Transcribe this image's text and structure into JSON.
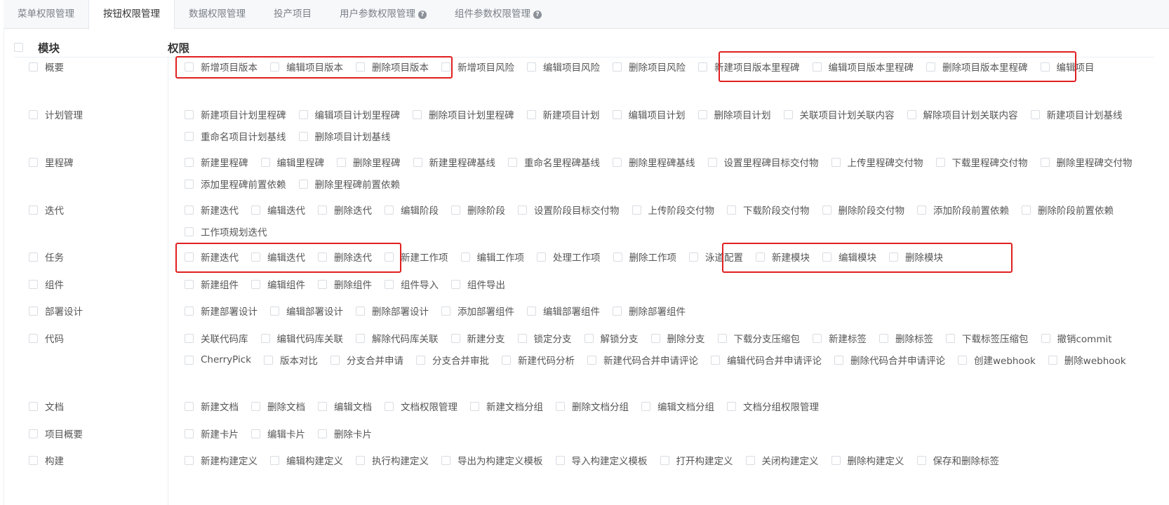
{
  "tabs": [
    {
      "label": "菜单权限管理",
      "active": false,
      "help": false
    },
    {
      "label": "按钮权限管理",
      "active": true,
      "help": false
    },
    {
      "label": "数据权限管理",
      "active": false,
      "help": false
    },
    {
      "label": "投产项目",
      "active": false,
      "help": false
    },
    {
      "label": "用户参数权限管理",
      "active": false,
      "help": true
    },
    {
      "label": "组件参数权限管理",
      "active": false,
      "help": true
    }
  ],
  "header": {
    "module": "模块",
    "permission": "权限"
  },
  "help_glyph": "?",
  "accent_color": "#e02020",
  "modules": [
    {
      "name": "概要",
      "perms": [
        "新增项目版本",
        "编辑项目版本",
        "删除项目版本",
        "新增项目风险",
        "编辑项目风险",
        "删除项目风险",
        "新建项目版本里程碑",
        "编辑项目版本里程碑",
        "删除项目版本里程碑",
        "编辑项目"
      ]
    },
    {
      "name": "计划管理",
      "perms": [
        "新建项目计划里程碑",
        "编辑项目计划里程碑",
        "删除项目计划里程碑",
        "新建项目计划",
        "编辑项目计划",
        "删除项目计划",
        "关联项目计划关联内容",
        "解除项目计划关联内容",
        "新建项目计划基线",
        "重命名项目计划基线",
        "删除项目计划基线"
      ]
    },
    {
      "name": "里程碑",
      "perms": [
        "新建里程碑",
        "编辑里程碑",
        "删除里程碑",
        "新建里程碑基线",
        "重命名里程碑基线",
        "删除里程碑基线",
        "设置里程碑目标交付物",
        "上传里程碑交付物",
        "下载里程碑交付物",
        "删除里程碑交付物",
        "添加里程碑前置依赖",
        "删除里程碑前置依赖"
      ]
    },
    {
      "name": "迭代",
      "perms": [
        "新建迭代",
        "编辑迭代",
        "删除迭代",
        "编辑阶段",
        "删除阶段",
        "设置阶段目标交付物",
        "上传阶段交付物",
        "下载阶段交付物",
        "删除阶段交付物",
        "添加阶段前置依赖",
        "删除阶段前置依赖",
        "工作项规划迭代"
      ]
    },
    {
      "name": "任务",
      "perms": [
        "新建迭代",
        "编辑迭代",
        "删除迭代",
        "新建工作项",
        "编辑工作项",
        "处理工作项",
        "删除工作项",
        "泳道配置",
        "新建模块",
        "编辑模块",
        "删除模块"
      ]
    },
    {
      "name": "组件",
      "perms": [
        "新建组件",
        "编辑组件",
        "删除组件",
        "组件导入",
        "组件导出"
      ]
    },
    {
      "name": "部署设计",
      "perms": [
        "新建部署设计",
        "编辑部署设计",
        "删除部署设计",
        "添加部署组件",
        "编辑部署组件",
        "删除部署组件"
      ]
    },
    {
      "name": "代码",
      "perms": [
        "关联代码库",
        "编辑代码库关联",
        "解除代码库关联",
        "新建分支",
        "锁定分支",
        "解锁分支",
        "删除分支",
        "下载分支压缩包",
        "新建标签",
        "删除标签",
        "下载标签压缩包",
        "撤销commit",
        "CherryPick",
        "版本对比",
        "分支合并申请",
        "分支合并审批",
        "新建代码分析",
        "新建代码合并申请评论",
        "编辑代码合并申请评论",
        "删除代码合并申请评论",
        "创建webhook",
        "删除webhook"
      ]
    },
    {
      "name": "文档",
      "perms": [
        "新建文档",
        "删除文档",
        "编辑文档",
        "文档权限管理",
        "新建文档分组",
        "删除文档分组",
        "编辑文档分组",
        "文档分组权限管理"
      ]
    },
    {
      "name": "项目概要",
      "perms": [
        "新建卡片",
        "编辑卡片",
        "删除卡片"
      ]
    },
    {
      "name": "构建",
      "perms": [
        "新建构建定义",
        "编辑构建定义",
        "执行构建定义",
        "导出为构建定义模板",
        "导入构建定义模板",
        "打开构建定义",
        "关闭构建定义",
        "删除构建定义",
        "保存和删除标签"
      ]
    }
  ]
}
